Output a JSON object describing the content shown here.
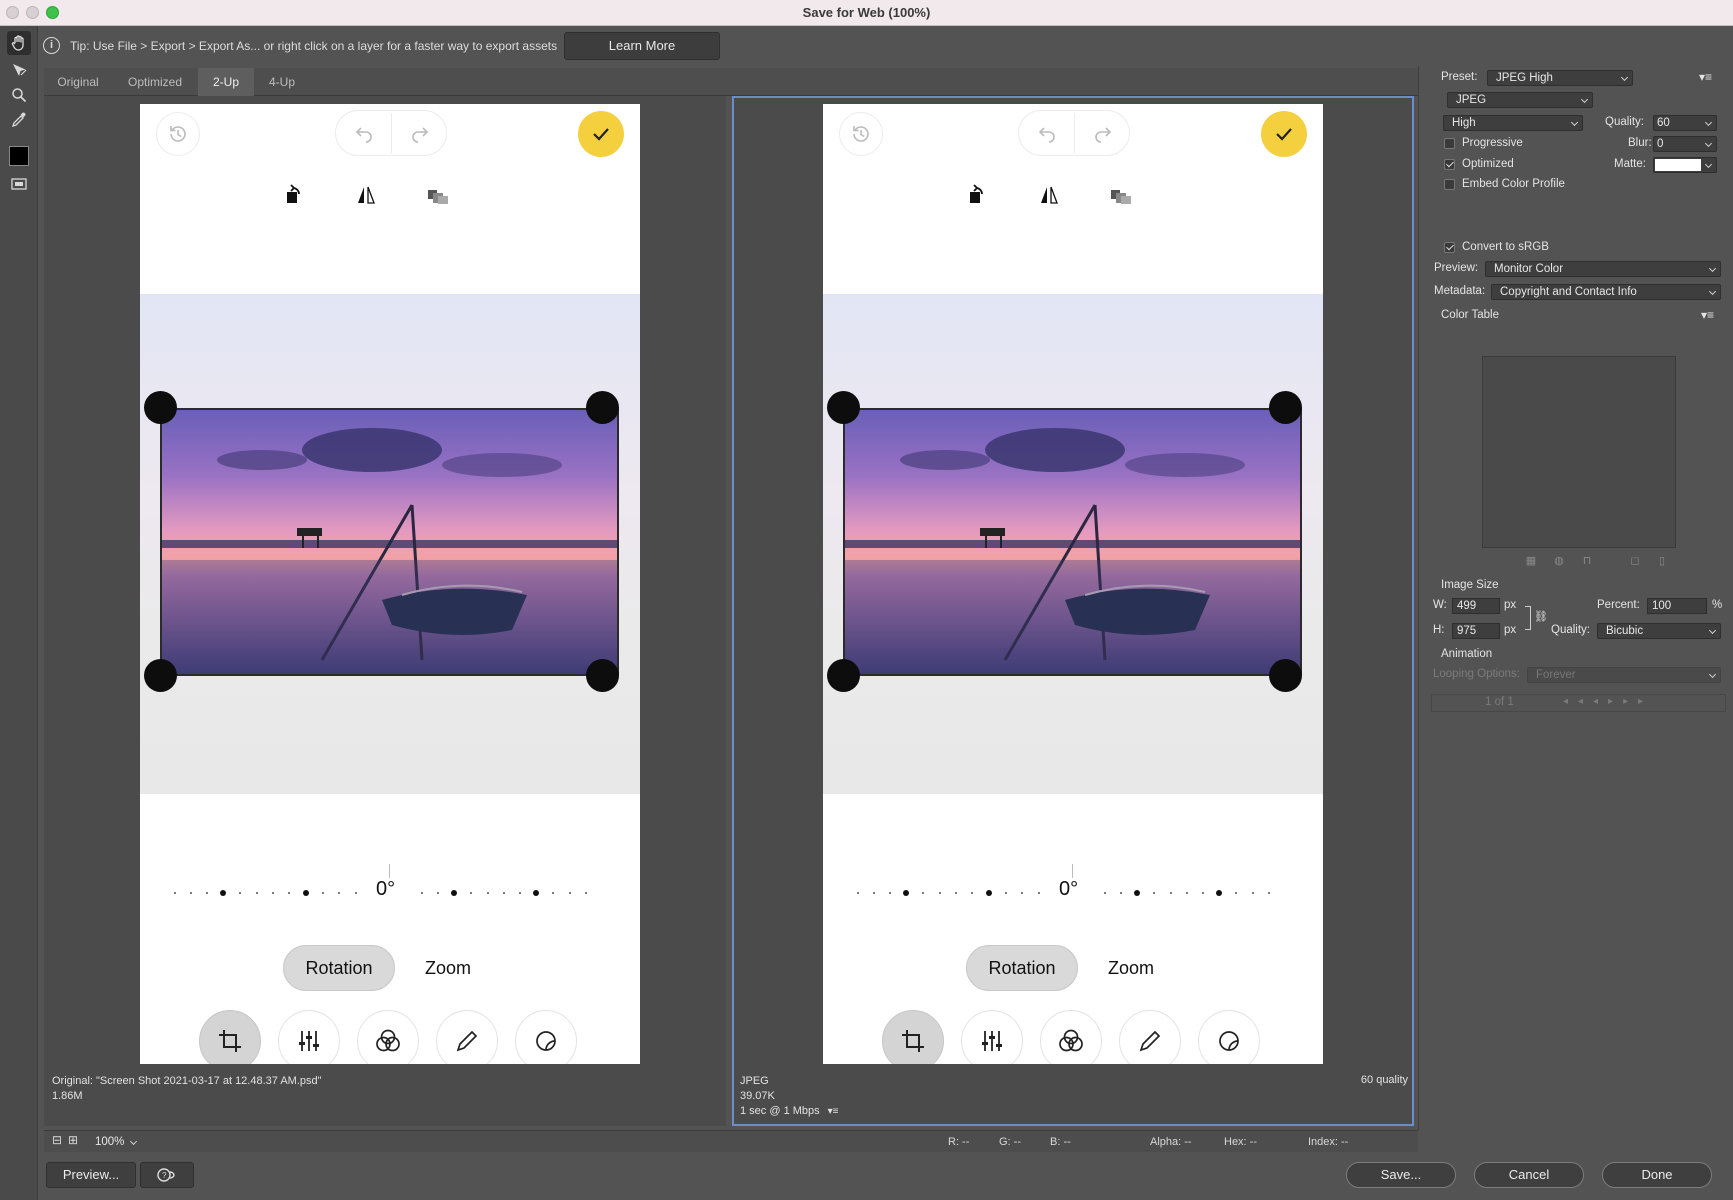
{
  "window": {
    "title": "Save for Web (100%)"
  },
  "tip": {
    "text": "Tip: Use File > Export > Export As...  or right click on a layer for a faster way to export assets",
    "learn_more": "Learn More"
  },
  "tabs": [
    {
      "label": "Original",
      "active": false
    },
    {
      "label": "Optimized",
      "active": false
    },
    {
      "label": "2-Up",
      "active": true
    },
    {
      "label": "4-Up",
      "active": false
    }
  ],
  "phone": {
    "rotation_value": "0°",
    "rotation_tab": "Rotation",
    "zoom_tab": "Zoom"
  },
  "left_pane": {
    "line1": "Original: \"Screen Shot 2021-03-17 at 12.48.37 AM.psd\"",
    "line2": "1.86M"
  },
  "right_pane": {
    "format": "JPEG",
    "size": "39.07K",
    "speed": "1 sec @ 1 Mbps",
    "quality": "60 quality"
  },
  "settings": {
    "preset_label": "Preset:",
    "preset_value": "JPEG High",
    "format_value": "JPEG",
    "compression_value": "High",
    "quality_label": "Quality:",
    "quality_value": "60",
    "progressive_label": "Progressive",
    "progressive_checked": false,
    "blur_label": "Blur:",
    "blur_value": "0",
    "optimized_label": "Optimized",
    "optimized_checked": true,
    "matte_label": "Matte:",
    "matte_color": "#ffffff",
    "embed_label": "Embed Color Profile",
    "embed_checked": false,
    "srgb_label": "Convert to sRGB",
    "srgb_checked": true,
    "preview_label": "Preview:",
    "preview_value": "Monitor Color",
    "metadata_label": "Metadata:",
    "metadata_value": "Copyright and Contact Info",
    "color_table_label": "Color Table",
    "image_size_label": "Image Size",
    "w_label": "W:",
    "w_value": "499",
    "h_label": "H:",
    "h_value": "975",
    "px": "px",
    "percent_label": "Percent:",
    "percent_value": "100",
    "percent_unit": "%",
    "resample_label": "Quality:",
    "resample_value": "Bicubic",
    "animation_label": "Animation",
    "looping_label": "Looping Options:",
    "looping_value": "Forever",
    "frame_counter": "1 of 1"
  },
  "status": {
    "zoom": "100%",
    "r": "R: --",
    "g": "G: --",
    "b": "B: --",
    "alpha": "Alpha: --",
    "hex": "Hex: --",
    "index": "Index: --"
  },
  "buttons": {
    "preview": "Preview...",
    "save": "Save...",
    "cancel": "Cancel",
    "done": "Done"
  },
  "colors": {
    "accent_yellow": "#f4d03f",
    "selection_blue": "#6a8ec9",
    "panel_bg": "#535353"
  }
}
